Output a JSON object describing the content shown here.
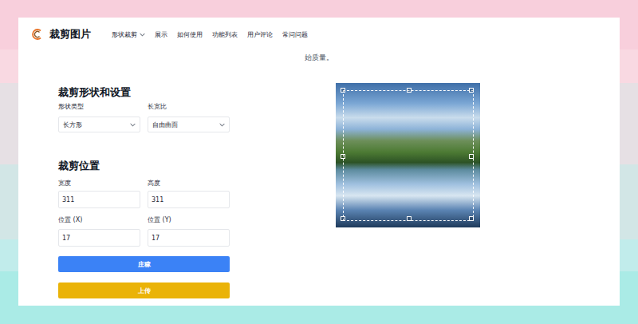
{
  "logo": {
    "name": "裁剪图片"
  },
  "nav": [
    {
      "label": "形状裁剪",
      "dropdown": true
    },
    {
      "label": "展示",
      "dropdown": false
    },
    {
      "label": "如何使用",
      "dropdown": false
    },
    {
      "label": "功能列表",
      "dropdown": false
    },
    {
      "label": "用户评论",
      "dropdown": false
    },
    {
      "label": "常问问题",
      "dropdown": false
    }
  ],
  "intro_tail": "始质量。",
  "settings": {
    "heading": "裁剪形状和设置",
    "selects": [
      {
        "label": "形状类型",
        "value": "长方形"
      },
      {
        "label": "长宽比",
        "value": "自由曲面"
      }
    ]
  },
  "position": {
    "heading": "裁剪位置",
    "fields": [
      {
        "label": "宽度",
        "value": "311"
      },
      {
        "label": "高度",
        "value": "311"
      },
      {
        "label": "位置 (X)",
        "value": "17"
      },
      {
        "label": "位置 (Y)",
        "value": "17"
      }
    ]
  },
  "buttons": [
    {
      "label": "庄稼",
      "color": "#3b82f6"
    },
    {
      "label": "上传",
      "color": "#eab308"
    }
  ]
}
